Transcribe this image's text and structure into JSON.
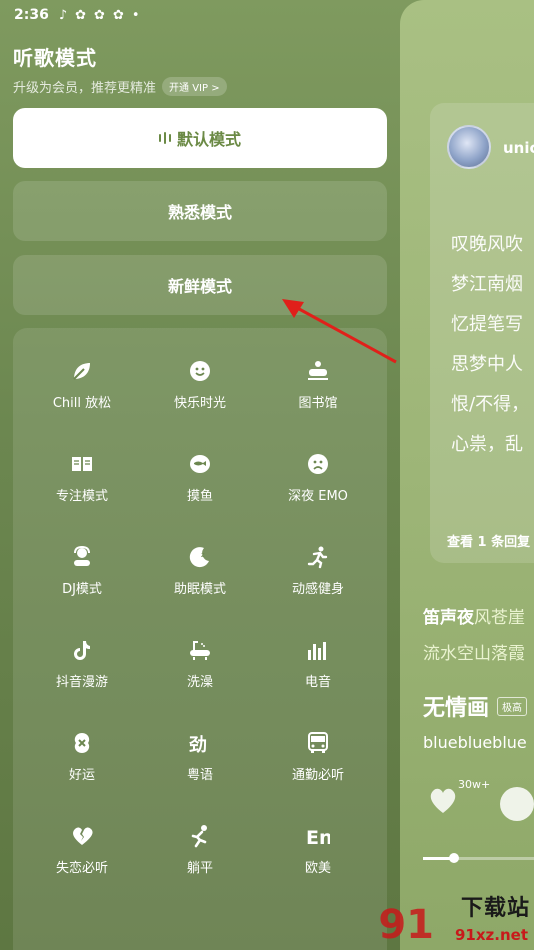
{
  "status_bar": {
    "time": "2:36",
    "app_icons": [
      "music-note-icon",
      "app-icon",
      "app-icon",
      "app-icon"
    ],
    "dot": "•"
  },
  "left": {
    "title": "听歌模式",
    "subtitle": "升级为会员，推荐更精准",
    "vip_label": "开通 VIP >",
    "modes": {
      "default": "默认模式",
      "familiar": "熟悉模式",
      "fresh": "新鲜模式"
    },
    "scenes": [
      {
        "label": "Chill 放松",
        "icon": "leaf-icon"
      },
      {
        "label": "快乐时光",
        "icon": "smile-icon"
      },
      {
        "label": "图书馆",
        "icon": "library-icon"
      },
      {
        "label": "专注模式",
        "icon": "book-icon"
      },
      {
        "label": "摸鱼",
        "icon": "fish-icon"
      },
      {
        "label": "深夜 EMO",
        "icon": "sad-face-icon"
      },
      {
        "label": "DJ模式",
        "icon": "dj-icon"
      },
      {
        "label": "助眠模式",
        "icon": "moon-icon"
      },
      {
        "label": "动感健身",
        "icon": "running-icon"
      },
      {
        "label": "抖音漫游",
        "icon": "tiktok-icon"
      },
      {
        "label": "洗澡",
        "icon": "bathtub-icon"
      },
      {
        "label": "电音",
        "icon": "equalizer-icon"
      },
      {
        "label": "好运",
        "icon": "luck-icon"
      },
      {
        "label": "粤语",
        "icon": "cantonese-icon"
      },
      {
        "label": "通勤必听",
        "icon": "bus-icon"
      },
      {
        "label": "失恋必听",
        "icon": "broken-heart-icon"
      },
      {
        "label": "躺平",
        "icon": "lying-icon"
      },
      {
        "label": "欧美",
        "icon": "english-icon"
      }
    ]
  },
  "right": {
    "user_name": "unic",
    "lyric_lines": [
      "叹晚风吹",
      "梦江南烟",
      "忆提笔写",
      "思梦中人",
      "恨/不得，",
      "心祟，乱"
    ],
    "view_replies": "查看 1 条回复",
    "song_lyric_1a": "笛声夜",
    "song_lyric_1b": "风苍崖",
    "song_lyric_2": "流水空山落霞",
    "song_title": "无情画",
    "quality_tag": "极高",
    "artist": "blueblueblue",
    "like_count": "30w+",
    "progress": 0.26
  },
  "watermark": {
    "text1": "下载站",
    "text2": "91xz.net",
    "logo": "91"
  }
}
